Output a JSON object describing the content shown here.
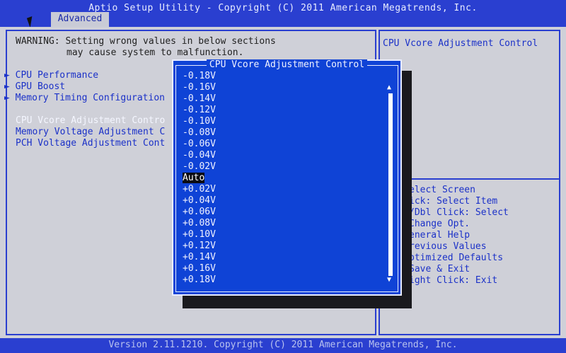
{
  "header": {
    "title": "Aptio Setup Utility - Copyright (C) 2011 American Megatrends, Inc.",
    "active_tab": "Advanced"
  },
  "main": {
    "warning_line1": "WARNING: Setting wrong values in below sections",
    "warning_line2": "may cause system to malfunction.",
    "submenus": [
      {
        "label": "CPU Performance",
        "arrow": "►"
      },
      {
        "label": "GPU Boost",
        "arrow": "►"
      },
      {
        "label": "Memory Timing Configuration",
        "arrow": "►"
      }
    ],
    "settings": [
      {
        "label": "CPU Vcore Adjustment Contro"
      },
      {
        "label": "Memory Voltage Adjustment C"
      },
      {
        "label": "PCH Voltage Adjustment Cont"
      }
    ]
  },
  "help": {
    "description": "CPU Vcore Adjustment Control",
    "keys": [
      "elect Screen",
      "ick: Select Item",
      "/Dbl Click: Select",
      "Change Opt.",
      "eneral Help",
      "revious Values",
      "ptimized Defaults",
      "Save & Exit",
      "ight Click: Exit"
    ]
  },
  "popup": {
    "title": "CPU Vcore Adjustment Control",
    "options": [
      "-0.18V",
      "-0.16V",
      "-0.14V",
      "-0.12V",
      "-0.10V",
      "-0.08V",
      "-0.06V",
      "-0.04V",
      "-0.02V",
      "Auto",
      "+0.02V",
      "+0.04V",
      "+0.06V",
      "+0.08V",
      "+0.10V",
      "+0.12V",
      "+0.14V",
      "+0.16V",
      "+0.18V"
    ],
    "selected": "Auto"
  },
  "footer": {
    "text": "Version 2.11.1210. Copyright (C) 2011 American Megatrends, Inc."
  },
  "icons": {
    "scroll_up": "up-arrow",
    "scroll_down": "down-arrow",
    "submenu": "right-triangle",
    "cursor": "mouse-pointer"
  }
}
